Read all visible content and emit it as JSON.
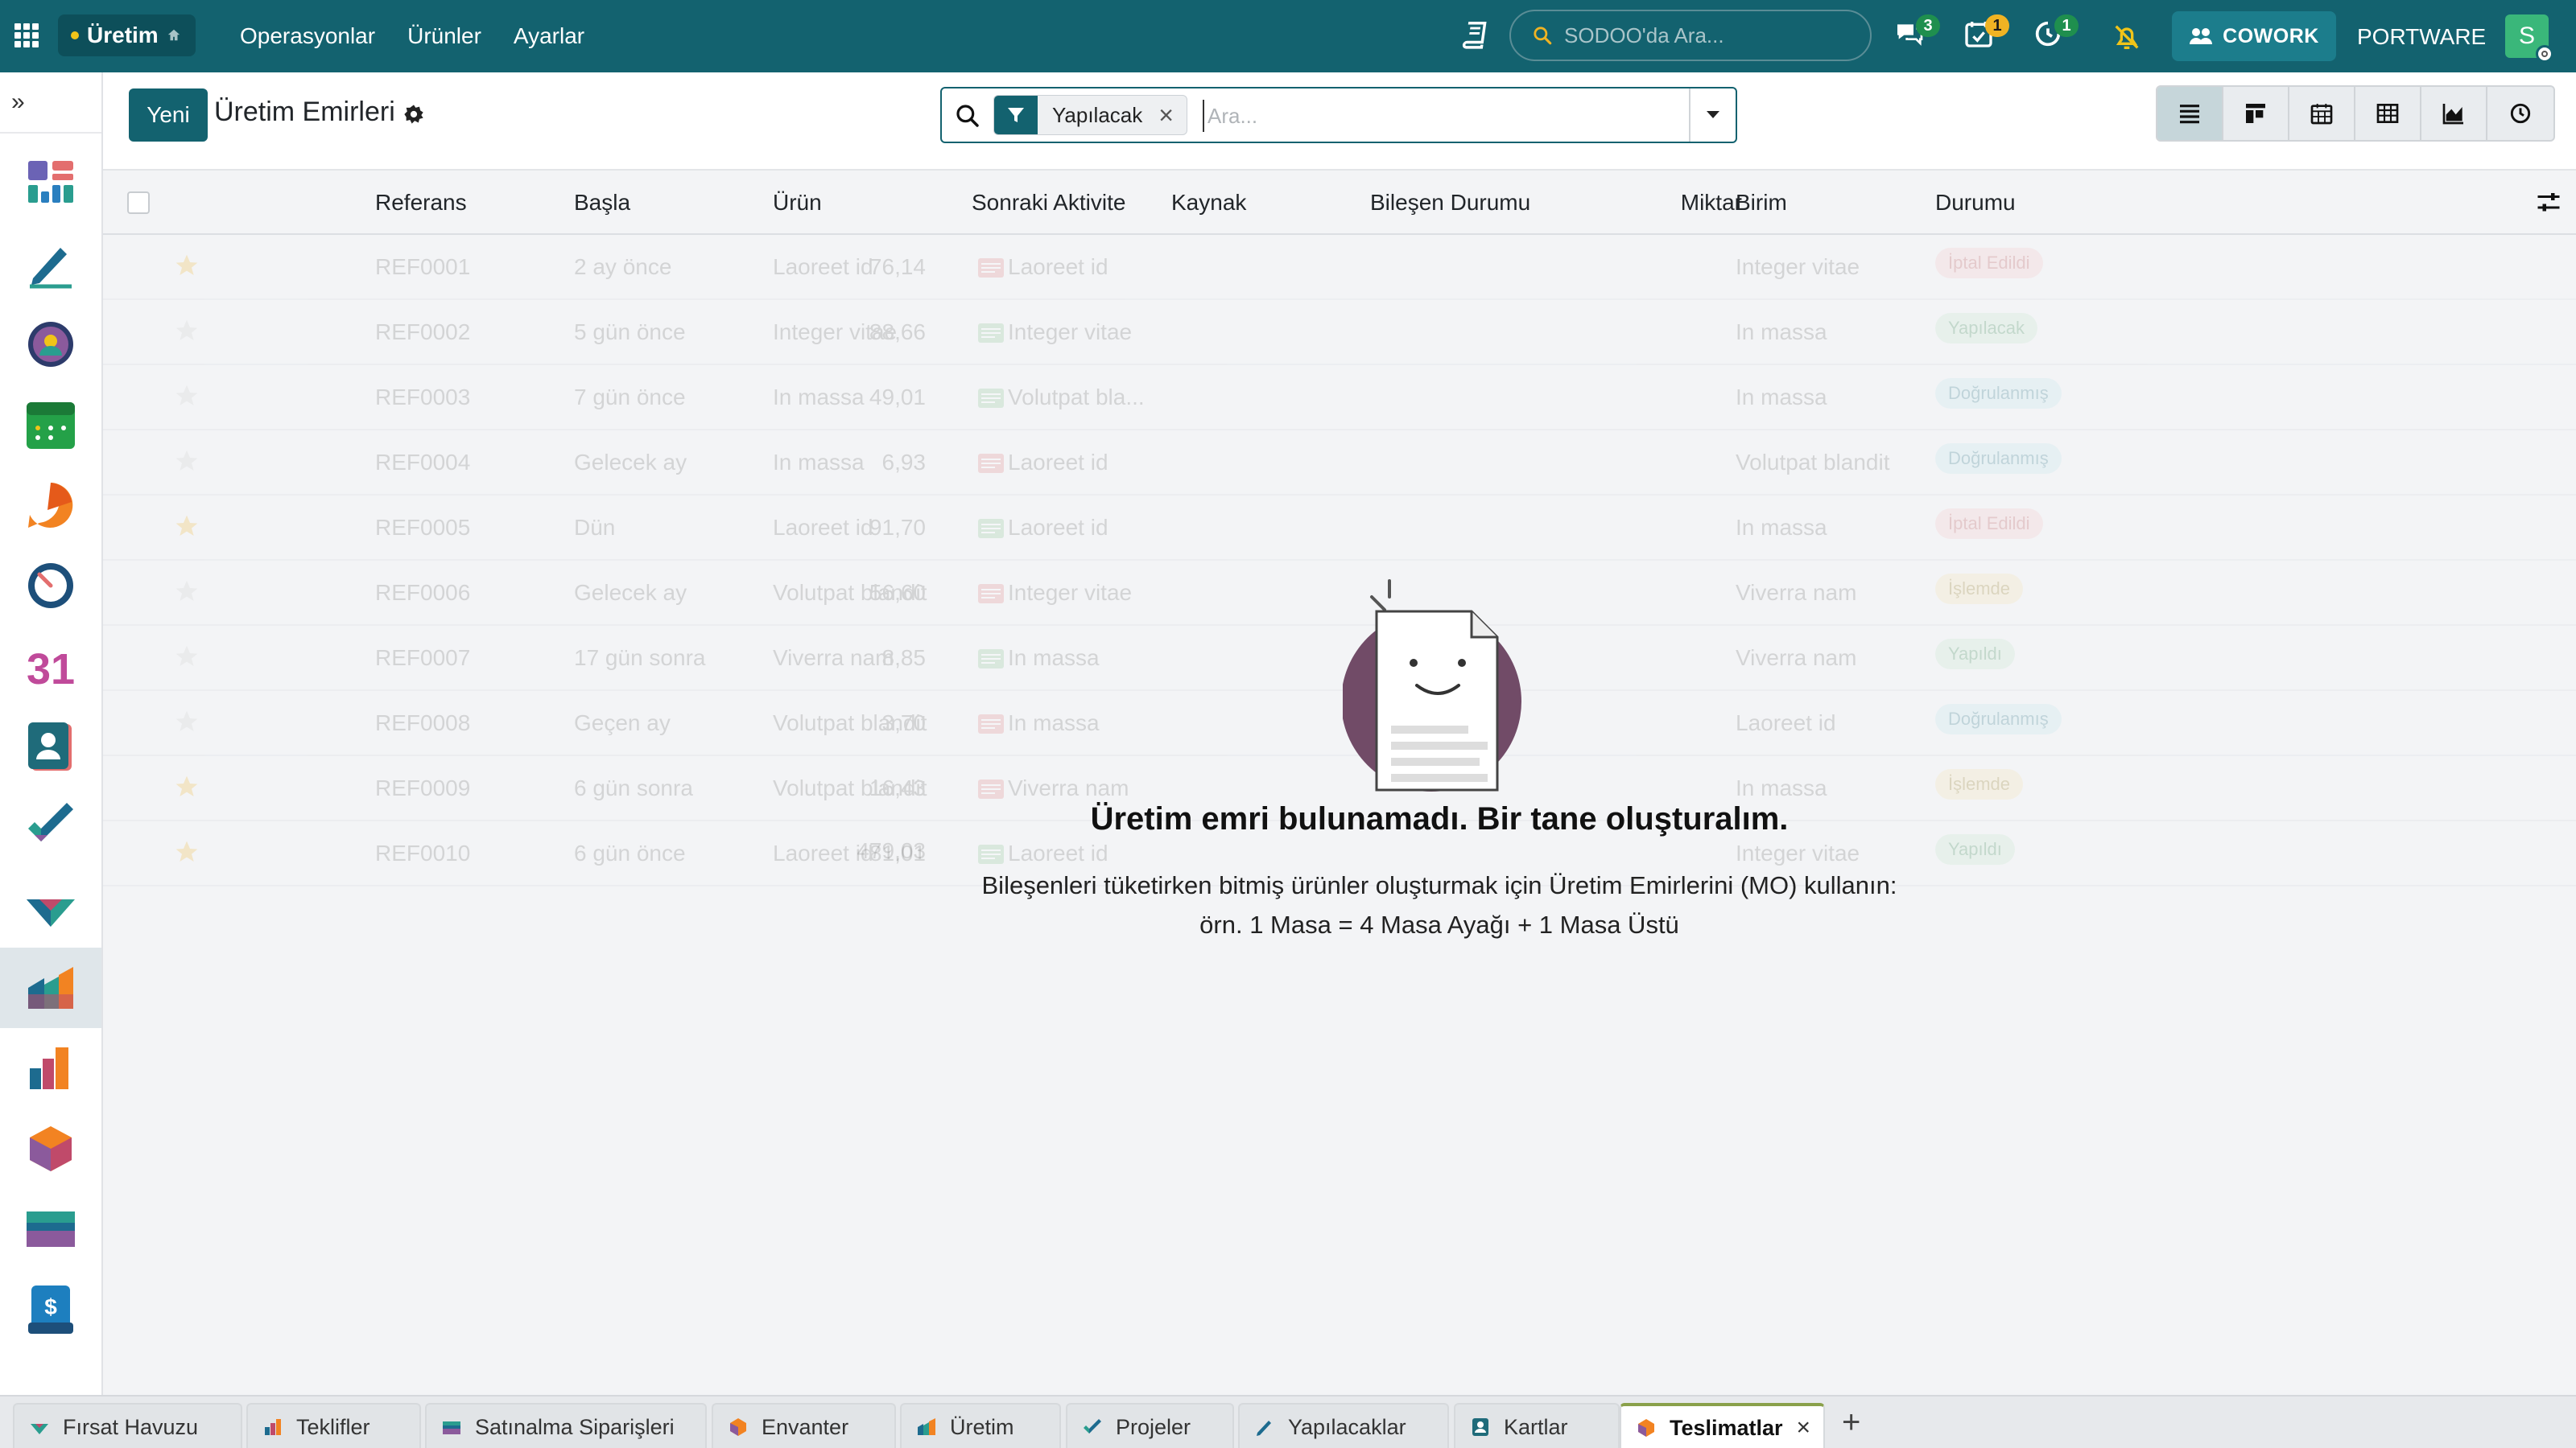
{
  "topbar": {
    "app_name": "Üretim",
    "menu": [
      "Operasyonlar",
      "Ürünler",
      "Ayarlar"
    ],
    "search_placeholder": "SODOO'da Ara...",
    "messages_count": "3",
    "activities_count": "1",
    "timer_count": "1",
    "cowork_label": "COWORK",
    "company": "PORTWARE",
    "avatar_letter": "S"
  },
  "control": {
    "new_button": "Yeni",
    "title": "Üretim Emirleri",
    "facet_label": "Yapılacak",
    "search_placeholder": "Ara..."
  },
  "columns": [
    "Referans",
    "Başla",
    "Ürün",
    "Sonraki Aktivite",
    "Kaynak",
    "Bileşen Durumu",
    "Miktar",
    "Birim",
    "Durumu"
  ],
  "sample_rows": [
    {
      "starred": true,
      "ref": "REF0001",
      "start": "2 ay önce",
      "product": "Laoreet id",
      "activity": "Laoreet id",
      "activity_color": "#e07a7a",
      "qty": "76,14",
      "unit": "Integer vitae",
      "state": "İptal Edildi",
      "state_kind": "red"
    },
    {
      "starred": false,
      "ref": "REF0002",
      "start": "5 gün önce",
      "product": "Integer vitae",
      "activity": "Integer vitae",
      "activity_color": "#7fbf8a",
      "qty": "88,66",
      "unit": "In massa",
      "state": "Yapılacak",
      "state_kind": "green"
    },
    {
      "starred": false,
      "ref": "REF0003",
      "start": "7 gün önce",
      "product": "In massa",
      "activity": "Volutpat bla...",
      "activity_color": "#7fbf8a",
      "qty": "49,01",
      "unit": "In massa",
      "state": "Doğrulanmış",
      "state_kind": "teal"
    },
    {
      "starred": false,
      "ref": "REF0004",
      "start": "Gelecek ay",
      "product": "In massa",
      "activity": "Laoreet id",
      "activity_color": "#e07a7a",
      "qty": "6,93",
      "unit": "Volutpat blandit",
      "state": "Doğrulanmış",
      "state_kind": "teal"
    },
    {
      "starred": true,
      "ref": "REF0005",
      "start": "Dün",
      "product": "Laoreet id",
      "activity": "Laoreet id",
      "activity_color": "#7fbf8a",
      "qty": "91,70",
      "unit": "In massa",
      "state": "İptal Edildi",
      "state_kind": "red"
    },
    {
      "starred": false,
      "ref": "REF0006",
      "start": "Gelecek ay",
      "product": "Volutpat blandit",
      "activity": "Integer vitae",
      "activity_color": "#e07a7a",
      "qty": "56,60",
      "unit": "Viverra nam",
      "state": "İşlemde",
      "state_kind": "yellow"
    },
    {
      "starred": false,
      "ref": "REF0007",
      "start": "17 gün sonra",
      "product": "Viverra nam",
      "activity": "In massa",
      "activity_color": "#7fbf8a",
      "qty": "8,85",
      "unit": "Viverra nam",
      "state": "Yapıldı",
      "state_kind": "green"
    },
    {
      "starred": false,
      "ref": "REF0008",
      "start": "Geçen ay",
      "product": "Volutpat blandit",
      "activity": "In massa",
      "activity_color": "#e07a7a",
      "qty": "3,70",
      "unit": "Laoreet id",
      "state": "Doğrulanmış",
      "state_kind": "teal"
    },
    {
      "starred": true,
      "ref": "REF0009",
      "start": "6 gün sonra",
      "product": "Volutpat blandit",
      "activity": "Viverra nam",
      "activity_color": "#e07a7a",
      "qty": "16,43",
      "unit": "In massa",
      "state": "İşlemde",
      "state_kind": "yellow"
    },
    {
      "starred": true,
      "ref": "REF0010",
      "start": "6 gün önce",
      "product": "Laoreet id",
      "activity": "Laoreet id",
      "activity_color": "#7fbf8a",
      "qty": "81,01",
      "unit": "Integer vitae",
      "state": "Yapıldı",
      "state_kind": "green"
    }
  ],
  "sample_total": "479,03",
  "empty": {
    "title": "Üretim emri bulunamadı. Bir tane oluşturalım.",
    "line1": "Bileşenleri tüketirken bitmiş ürünler oluşturmak için Üretim Emirlerini (MO) kullanın:",
    "line2": "örn. 1 Masa = 4 Masa Ayağı + 1 Masa Üstü"
  },
  "tabs": [
    {
      "label": "Fırsat Havuzu",
      "icon": "crm-icon"
    },
    {
      "label": "Teklifler",
      "icon": "sales-icon"
    },
    {
      "label": "Satınalma Siparişleri",
      "icon": "purchase-icon"
    },
    {
      "label": "Envanter",
      "icon": "inventory-icon"
    },
    {
      "label": "Üretim",
      "icon": "manufacturing-icon"
    },
    {
      "label": "Projeler",
      "icon": "project-icon"
    },
    {
      "label": "Yapılacaklar",
      "icon": "todo-icon"
    },
    {
      "label": "Kartlar",
      "icon": "contacts-icon"
    },
    {
      "label": "Teslimatlar",
      "icon": "inventory-icon",
      "active": true
    }
  ],
  "colors": {
    "brand": "#13626f",
    "badge_green": "#1f8f4e",
    "badge_yellow": "#f0b323",
    "active_tab_accent": "#8aa14a"
  }
}
